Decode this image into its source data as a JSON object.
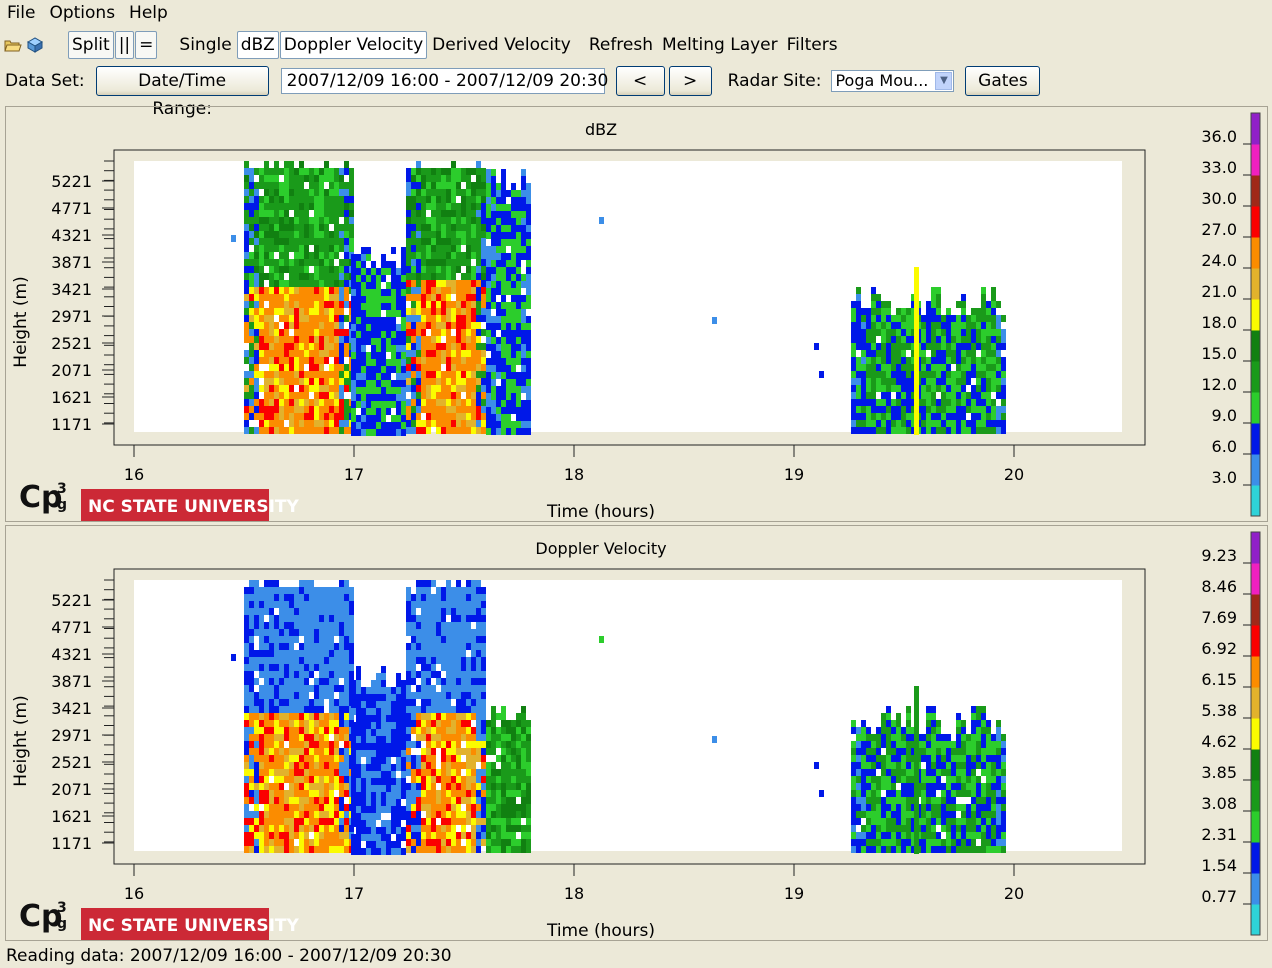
{
  "menu": [
    "File",
    "Options",
    "Help"
  ],
  "toolbar": {
    "icons": [
      "open-folder-icon",
      "open-data-icon"
    ],
    "split_label": "Split",
    "parallel_label": "||",
    "equal_label": "=",
    "single_label": "Single",
    "dbz_label": "dBZ",
    "doppler_label": "Doppler Velocity",
    "derived_label": "Derived Velocity",
    "refresh_label": "Refresh",
    "melting_label": "Melting Layer",
    "filters_label": "Filters"
  },
  "dataset": {
    "label": "Data Set:",
    "range_button": "Date/Time Range:",
    "range_value": "2007/12/09 16:00 - 2007/12/09 20:30",
    "prev_label": "<",
    "next_label": ">",
    "radar_label": "Radar Site:",
    "radar_value": "Poga Mou...",
    "gates_label": "Gates"
  },
  "plots": [
    {
      "title": "dBZ",
      "xlabel": "Time (hours)",
      "ylabel": "Height (m)",
      "xticks": [
        "16",
        "17",
        "18",
        "19",
        "20"
      ],
      "yticks": [
        "5221",
        "4771",
        "4321",
        "3871",
        "3421",
        "2971",
        "2521",
        "2071",
        "1621",
        "1171"
      ],
      "scale": [
        "36.0",
        "33.0",
        "30.0",
        "27.0",
        "24.0",
        "21.0",
        "18.0",
        "15.0",
        "12.0",
        "9.0",
        "6.0",
        "3.0"
      ],
      "logo_text": "Cp3g",
      "university": "NC STATE UNIVERSITY"
    },
    {
      "title": "Doppler Velocity",
      "xlabel": "Time (hours)",
      "ylabel": "Height (m)",
      "xticks": [
        "16",
        "17",
        "18",
        "19",
        "20"
      ],
      "yticks": [
        "5221",
        "4771",
        "4321",
        "3871",
        "3421",
        "2971",
        "2521",
        "2071",
        "1621",
        "1171"
      ],
      "scale": [
        "9.23",
        "8.46",
        "7.69",
        "6.92",
        "6.15",
        "5.38",
        "4.62",
        "3.85",
        "3.08",
        "2.31",
        "1.54",
        "0.77"
      ],
      "logo_text": "Cp3g",
      "university": "NC STATE UNIVERSITY"
    }
  ],
  "colors": {
    "scale_bands": [
      "#2ed3d8",
      "#3c8ee8",
      "#0018e8",
      "#2ccd2c",
      "#1a9a1a",
      "#118011",
      "#fbfb00",
      "#e2b22c",
      "#fb8c00",
      "#fb0000",
      "#a02818",
      "#f020c0",
      "#9020c8"
    ]
  },
  "status": "Reading data: 2007/12/09 16:00 - 2007/12/09 20:30"
}
